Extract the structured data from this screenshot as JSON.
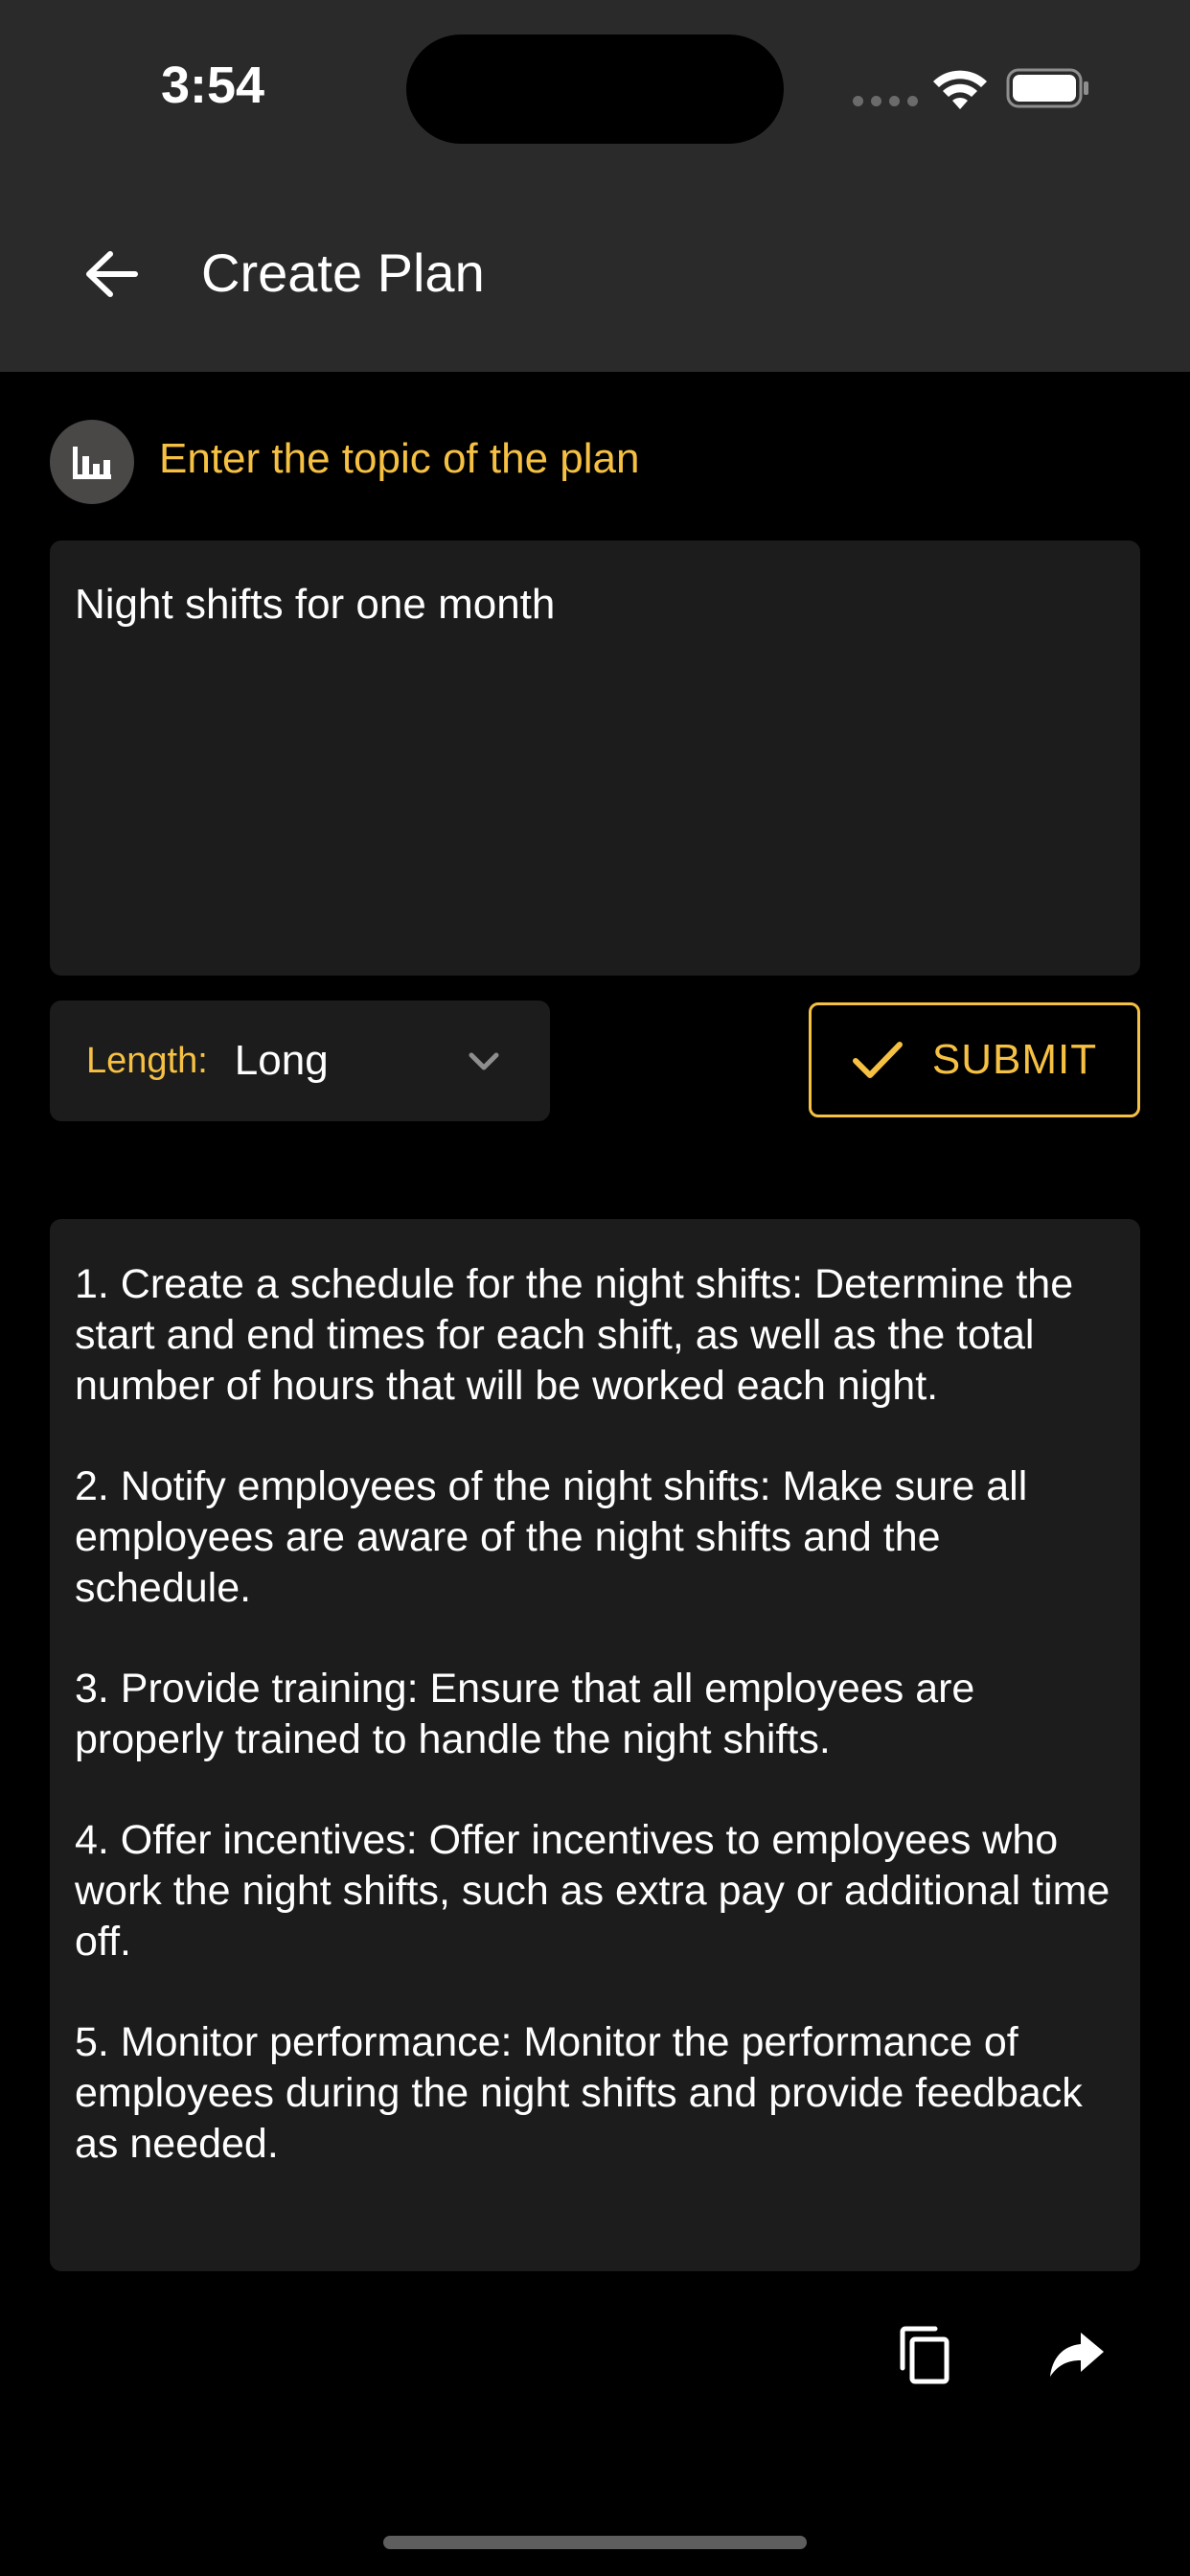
{
  "status_bar": {
    "time": "3:54",
    "icons": [
      "signal-dots-icon",
      "wifi-icon",
      "battery-icon"
    ]
  },
  "header": {
    "back_icon": "arrow-left-icon",
    "title": "Create Plan"
  },
  "prompt": {
    "icon": "bar-chart-icon",
    "label": "Enter the topic of the plan",
    "value": "Night shifts for one month"
  },
  "options": {
    "length_label": "Length:",
    "length_value": "Long"
  },
  "submit": {
    "label": "SUBMIT",
    "icon": "checkmark-icon"
  },
  "result": {
    "items": [
      "1. Create a schedule for the night shifts: Determine the start and end times for each shift, as well as the total number of hours that will be worked each night.",
      "2. Notify employees of the night shifts: Make sure all employees are aware of the night shifts and the schedule.",
      "3. Provide training: Ensure that all employees are properly trained to handle the night shifts.",
      "4. Offer incentives: Offer incentives to employees who work the night shifts, such as extra pay or additional time off.",
      "5. Monitor performance: Monitor the performance of employees during the night shifts and provide feedback as needed."
    ]
  },
  "actions": {
    "copy_icon": "copy-icon",
    "share_icon": "share-icon"
  },
  "colors": {
    "accent": "#f6c143",
    "background": "#000000",
    "surface": "#1c1c1c",
    "appbar": "#2a2a2a"
  }
}
